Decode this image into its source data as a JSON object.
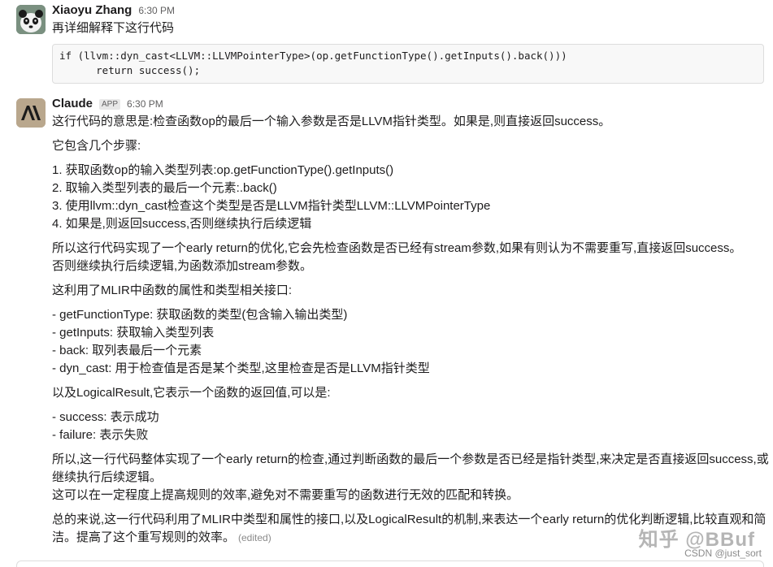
{
  "messages": {
    "user": {
      "name": "Xiaoyu Zhang",
      "time": "6:30 PM",
      "text": "再详细解释下这行代码",
      "code_line1": "if (llvm::dyn_cast<LLVM::LLVMPointerType>(op.getFunctionType().getInputs().back()))",
      "code_line2": "      return success();",
      "avatar_icon": "panda-avatar-icon"
    },
    "assistant": {
      "name": "Claude",
      "badge": "APP",
      "time": "6:30 PM",
      "avatar_icon": "claude-logo-icon",
      "lines": [
        "这行代码的意思是:检查函数op的最后一个输入参数是否是LLVM指针类型。如果是,则直接返回success。",
        "它包含几个步骤:",
        "1. 获取函数op的输入类型列表:op.getFunctionType().getInputs()",
        "2. 取输入类型列表的最后一个元素:.back()",
        "3. 使用llvm::dyn_cast检查这个类型是否是LLVM指针类型LLVM::LLVMPointerType",
        "4. 如果是,则返回success,否则继续执行后续逻辑",
        "所以这行代码实现了一个early return的优化,它会先检查函数是否已经有stream参数,如果有则认为不需要重写,直接返回success。",
        "否则继续执行后续逻辑,为函数添加stream参数。",
        "这利用了MLIR中函数的属性和类型相关接口:",
        "- getFunctionType: 获取函数的类型(包含输入输出类型)",
        "- getInputs: 获取输入类型列表",
        "- back: 取列表最后一个元素",
        "- dyn_cast: 用于检查值是否是某个类型,这里检查是否是LLVM指针类型",
        "以及LogicalResult,它表示一个函数的返回值,可以是:",
        "- success: 表示成功",
        "- failure: 表示失败",
        "所以,这一行代码整体实现了一个early return的检查,通过判断函数的最后一个参数是否已经是指针类型,来决定是否直接返回success,或",
        "继续执行后续逻辑。",
        "这可以在一定程度上提高规则的效率,避免对不需要重写的函数进行无效的匹配和转换。",
        "总的来说,这一行代码利用了MLIR中类型和属性的接口,以及LogicalResult的机制,来表达一个early return的优化判断逻辑,比较直观和简",
        "洁。提高了这个重写规则的效率。"
      ],
      "edited": "(edited)"
    }
  },
  "watermark": {
    "main": "知乎 @BBuf",
    "sub": "CSDN @just_sort"
  }
}
